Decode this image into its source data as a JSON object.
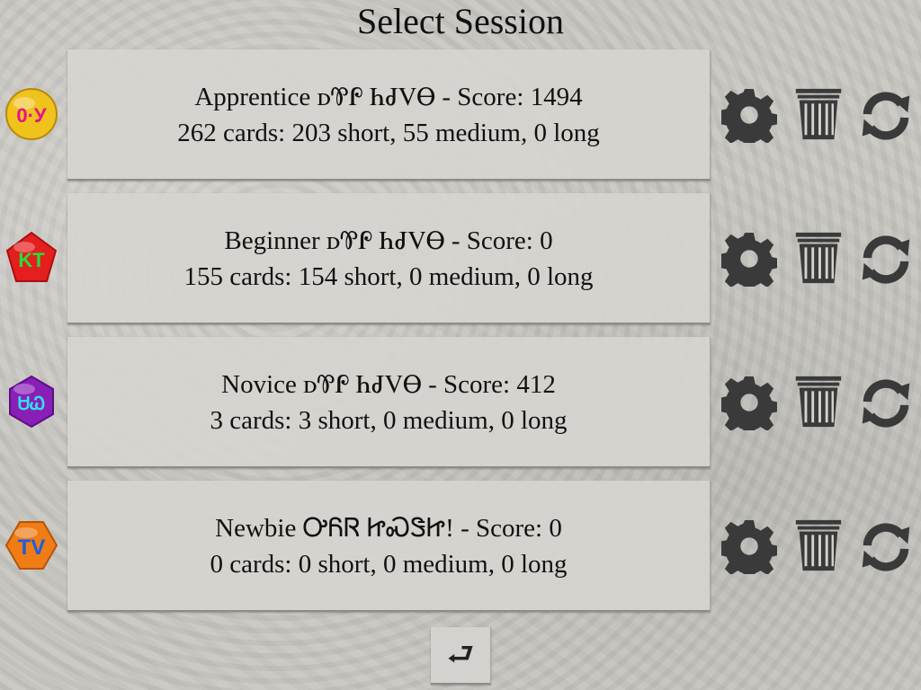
{
  "title": "Select Session",
  "sessions": [
    {
      "badge_text": "0·У",
      "badge_color": "#f0c21c",
      "badge_text_color": "#e8108c",
      "line1": "Apprentice ꭰᏈᎵ ᏂᏧᏙᎾ - Score: 1494",
      "line2": "262 cards: 203 short, 55 medium, 0 long",
      "settings_icon": "gear-icon",
      "delete_icon": "trash-icon",
      "reset_icon": "sync-icon"
    },
    {
      "badge_text": "KT",
      "badge_color": "#e51e1e",
      "badge_text_color": "#22e23a",
      "line1": "Beginner ꭰᏈᎵ ᏂᏧᏙᎾ - Score: 0",
      "line2": "155 cards: 154 short, 0 medium, 0 long",
      "settings_icon": "gear-icon",
      "delete_icon": "trash-icon",
      "reset_icon": "sync-icon"
    },
    {
      "badge_text": "ᏌᏇ",
      "badge_color": "#8a1fb8",
      "badge_text_color": "#2ee6ee",
      "line1": "Novice ꭰᏈᎵ ᏂᏧᏙᎾ - Score: 412",
      "line2": "3 cards: 3 short, 0 medium, 0 long",
      "settings_icon": "gear-icon",
      "delete_icon": "trash-icon",
      "reset_icon": "sync-icon"
    },
    {
      "badge_text": "TV",
      "badge_color": "#f07c16",
      "badge_text_color": "#1a5ee0",
      "line1": "Newbie ᎤᏲᏒ ᏥᏍᏕᏥ! - Score: 0",
      "line2": "0 cards: 0 short, 0 medium, 0 long",
      "settings_icon": "gear-icon",
      "delete_icon": "trash-icon",
      "reset_icon": "sync-icon"
    }
  ],
  "back_label": "⮐",
  "icon_color": "#3a3a3a"
}
